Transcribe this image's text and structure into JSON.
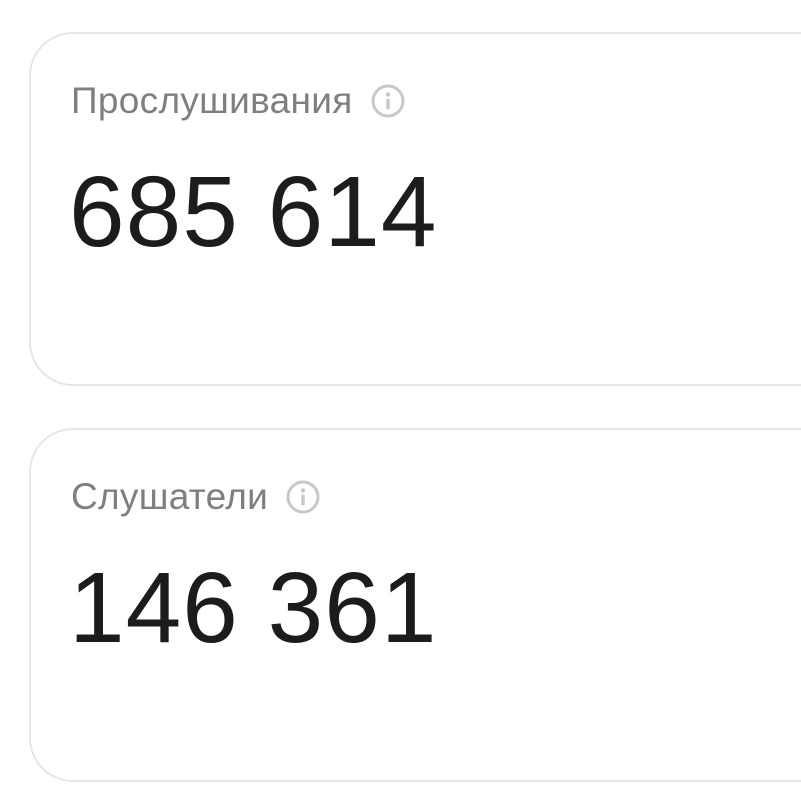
{
  "stats": {
    "plays": {
      "label": "Прослушивания",
      "value": "685 614",
      "icon": "info-icon"
    },
    "listeners": {
      "label": "Слушатели",
      "value": "146 361",
      "icon": "info-icon"
    }
  },
  "colors": {
    "label": "#7f7f7f",
    "value": "#1c1c1c",
    "border": "#e6e6e6",
    "icon": "#c8c8c8"
  }
}
